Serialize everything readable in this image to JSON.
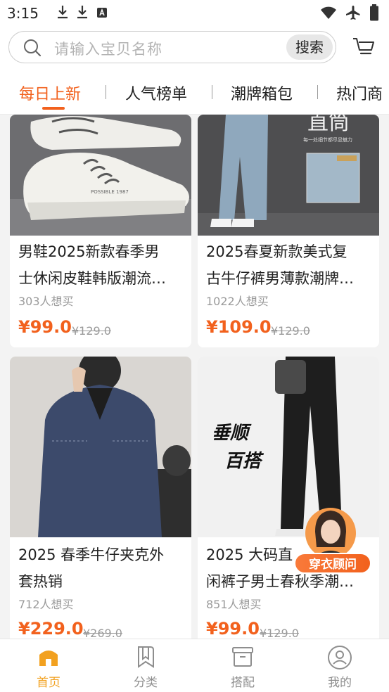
{
  "status_bar": {
    "time": "3:15",
    "left_icons": [
      "download-icon",
      "download-icon",
      "font-a-icon"
    ],
    "right_icons": [
      "wifi-icon",
      "airplane-icon",
      "battery-icon"
    ]
  },
  "search": {
    "placeholder": "请输入宝贝名称",
    "button_label": "搜索"
  },
  "tabs": [
    {
      "label": "每日上新",
      "active": true
    },
    {
      "label": "人气榜单",
      "active": false
    },
    {
      "label": "潮牌箱包",
      "active": false
    },
    {
      "label": "热门商",
      "active": false
    }
  ],
  "products": [
    {
      "title": "男鞋2025新款春季男\n士休闲皮鞋韩版潮流…",
      "wants": "303人想买",
      "price": "¥99.0",
      "original_price": "¥129.0",
      "image": "white-sneakers"
    },
    {
      "title": "2025春夏新款美式复\n古牛仔裤男薄款潮牌…",
      "wants": "1022人想买",
      "price": "¥109.0",
      "original_price": "¥129.0",
      "image": "light-blue-jeans",
      "image_text": "直筒"
    },
    {
      "title": "2025 春季牛仔夹克外\n套热销",
      "wants": "712人想买",
      "price": "¥229.0",
      "original_price": "¥269.0",
      "image": "denim-jacket"
    },
    {
      "title": "2025 大码直\n闲裤子男士春秋季潮…",
      "wants": "851人想买",
      "price": "¥99.0",
      "original_price": "¥129.0",
      "image": "black-wide-pants",
      "image_text_1": "垂顺",
      "image_text_2": "百搭"
    }
  ],
  "advisor_badge": "穿衣顾问",
  "bottom_nav": [
    {
      "label": "首页",
      "icon": "home-icon",
      "active": true
    },
    {
      "label": "分类",
      "icon": "bookmark-icon",
      "active": false
    },
    {
      "label": "搭配",
      "icon": "box-icon",
      "active": false
    },
    {
      "label": "我的",
      "icon": "profile-icon",
      "active": false
    }
  ],
  "colors": {
    "accent": "#f2611d",
    "nav_active": "#f2a120",
    "background": "#f3f3f3"
  }
}
